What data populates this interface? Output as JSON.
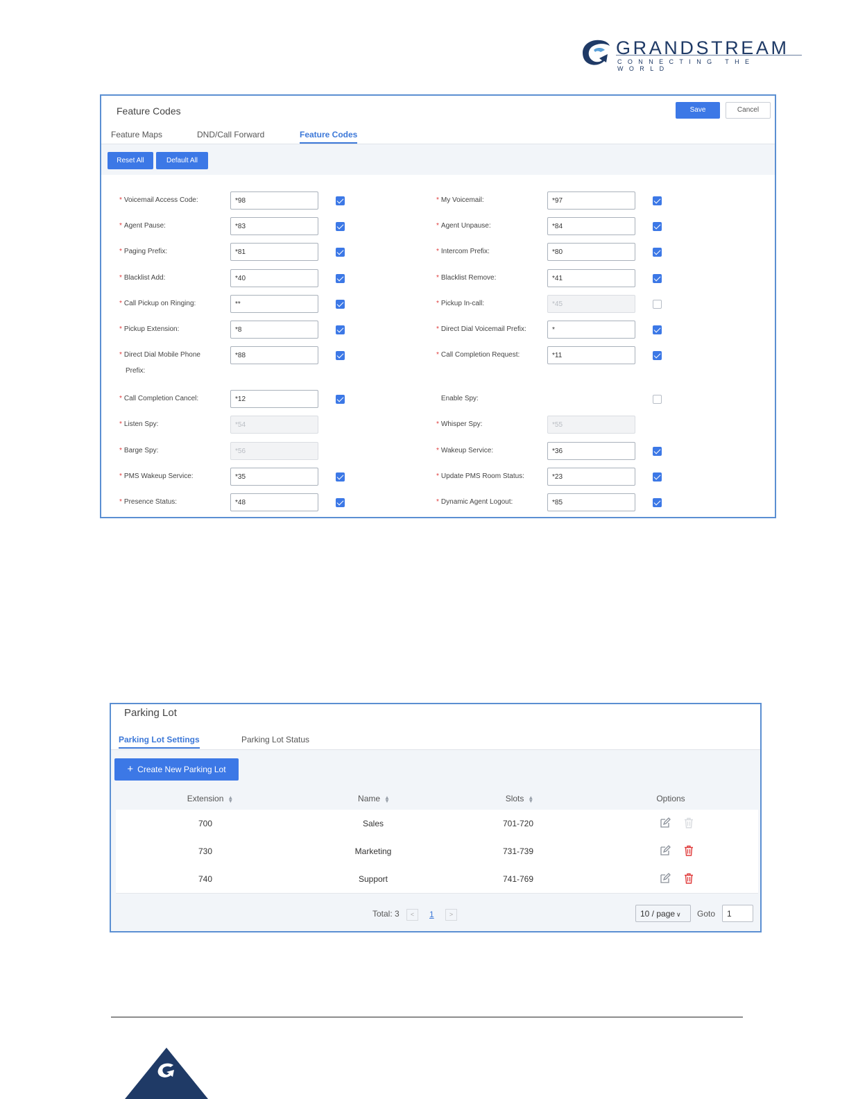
{
  "logo": {
    "brand": "GRANDSTREAM",
    "tagline": "CONNECTING THE WORLD"
  },
  "feature_codes": {
    "title": "Feature Codes",
    "save_label": "Save",
    "cancel_label": "Cancel",
    "tabs": [
      "Feature Maps",
      "DND/Call Forward",
      "Feature Codes"
    ],
    "active_tab": "Feature Codes",
    "reset_all_label": "Reset All",
    "default_all_label": "Default All",
    "left": [
      {
        "label": "Voicemail Access Code:",
        "required": true,
        "value": "*98",
        "enabled": true,
        "checked": true
      },
      {
        "label": "Agent Pause:",
        "required": true,
        "value": "*83",
        "enabled": true,
        "checked": true
      },
      {
        "label": "Paging Prefix:",
        "required": true,
        "value": "*81",
        "enabled": true,
        "checked": true
      },
      {
        "label": "Blacklist Add:",
        "required": true,
        "value": "*40",
        "enabled": true,
        "checked": true
      },
      {
        "label": "Call Pickup on Ringing:",
        "required": true,
        "value": "**",
        "enabled": true,
        "checked": true
      },
      {
        "label": "Pickup Extension:",
        "required": true,
        "value": "*8",
        "enabled": true,
        "checked": true
      },
      {
        "label": "Direct Dial Mobile Phone",
        "label_cont": "Prefix:",
        "required": true,
        "value": "*88",
        "enabled": true,
        "checked": true
      },
      {
        "label": "Call Completion Cancel:",
        "required": true,
        "value": "*12",
        "enabled": true,
        "checked": true
      },
      {
        "label": "Listen Spy:",
        "required": true,
        "value": "*54",
        "enabled": false
      },
      {
        "label": "Barge Spy:",
        "required": true,
        "value": "*56",
        "enabled": false
      },
      {
        "label": "PMS Wakeup Service:",
        "required": true,
        "value": "*35",
        "enabled": true,
        "checked": true
      },
      {
        "label": "Presence Status:",
        "required": true,
        "value": "*48",
        "enabled": true,
        "checked": true
      }
    ],
    "right": [
      {
        "label": "My Voicemail:",
        "required": true,
        "value": "*97",
        "enabled": true,
        "checked": true
      },
      {
        "label": "Agent Unpause:",
        "required": true,
        "value": "*84",
        "enabled": true,
        "checked": true
      },
      {
        "label": "Intercom Prefix:",
        "required": true,
        "value": "*80",
        "enabled": true,
        "checked": true
      },
      {
        "label": "Blacklist Remove:",
        "required": true,
        "value": "*41",
        "enabled": true,
        "checked": true
      },
      {
        "label": "Pickup In-call:",
        "required": true,
        "value": "*45",
        "enabled": false,
        "checked": false
      },
      {
        "label": "Direct Dial Voicemail Prefix:",
        "required": true,
        "value": "*",
        "enabled": true,
        "checked": true
      },
      {
        "label": "Call Completion Request:",
        "required": true,
        "value": "*11",
        "enabled": true,
        "checked": true
      },
      {
        "label": "Enable Spy:",
        "required": false,
        "checkbox_only": true,
        "checked": false
      },
      {
        "label": "Whisper Spy:",
        "required": true,
        "value": "*55",
        "enabled": false
      },
      {
        "label": "Wakeup Service:",
        "required": true,
        "value": "*36",
        "enabled": true,
        "checked": true
      },
      {
        "label": "Update PMS Room Status:",
        "required": true,
        "value": "*23",
        "enabled": true,
        "checked": true
      },
      {
        "label": "Dynamic Agent Logout:",
        "required": true,
        "value": "*85",
        "enabled": true,
        "checked": true
      }
    ]
  },
  "parking_lot": {
    "title": "Parking Lot",
    "tabs": [
      "Parking Lot Settings",
      "Parking Lot Status"
    ],
    "active_tab": "Parking Lot Settings",
    "create_button": "Create New Parking Lot",
    "columns": [
      "Extension",
      "Name",
      "Slots",
      "Options"
    ],
    "rows": [
      {
        "extension": "700",
        "name": "Sales",
        "slots": "701-720",
        "delete_enabled": false
      },
      {
        "extension": "730",
        "name": "Marketing",
        "slots": "731-739",
        "delete_enabled": true
      },
      {
        "extension": "740",
        "name": "Support",
        "slots": "741-769",
        "delete_enabled": true
      }
    ],
    "pagination": {
      "total": "Total: 3",
      "current_page": "1",
      "page_size": "10 / page",
      "goto_label": "Goto",
      "goto_value": "1"
    }
  },
  "colors": {
    "primary": "#3c78e6",
    "danger": "#e03b3b",
    "panel_border": "#5b8fd2"
  }
}
